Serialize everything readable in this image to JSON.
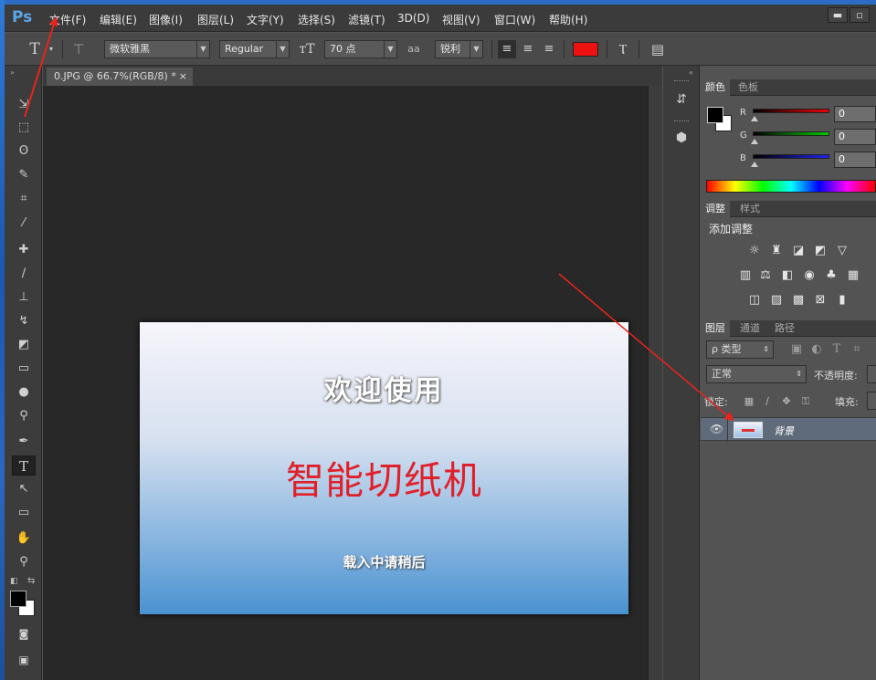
{
  "app": {
    "logo": "Ps"
  },
  "menu": [
    {
      "label": "文件(F)"
    },
    {
      "label": "编辑(E)"
    },
    {
      "label": "图像(I)"
    },
    {
      "label": "图层(L)"
    },
    {
      "label": "文字(Y)"
    },
    {
      "label": "选择(S)"
    },
    {
      "label": "滤镜(T)"
    },
    {
      "label": "3D(D)"
    },
    {
      "label": "视图(V)"
    },
    {
      "label": "窗口(W)"
    },
    {
      "label": "帮助(H)"
    }
  ],
  "window_controls": {
    "minimize": "▬",
    "restore": "▫"
  },
  "options": {
    "tool_glyph": "T",
    "font_family": "微软雅黑",
    "font_style": "Regular",
    "font_size": "70 点",
    "aa_mode_icon_text": "aa",
    "aa_mode": "锐利",
    "text_color": "#ee1111"
  },
  "document": {
    "tab_title": "0.JPG @ 66.7%(RGB/8) *",
    "tab_close": "×",
    "welcome": "欢迎使用",
    "product": "智能切纸机",
    "loading": "载入中请稍后"
  },
  "panels": {
    "color": {
      "tabs": [
        "颜色",
        "色板"
      ],
      "r_label": "R",
      "g_label": "G",
      "b_label": "B",
      "r_value": "0",
      "g_value": "0",
      "b_value": "0",
      "foreground": "#000000",
      "background": "#ffffff"
    },
    "adjustments": {
      "tabs": [
        "调整",
        "样式"
      ],
      "title": "添加调整"
    },
    "layers": {
      "tabs": [
        "图层",
        "通道",
        "路径"
      ],
      "filter_label": "ρ 类型",
      "blend_mode": "正常",
      "opacity_label": "不透明度:",
      "lock_label": "锁定:",
      "fill_label": "填充:",
      "layer_name": "背景"
    }
  },
  "annotation": {
    "arrow_color": "#e8241c"
  }
}
